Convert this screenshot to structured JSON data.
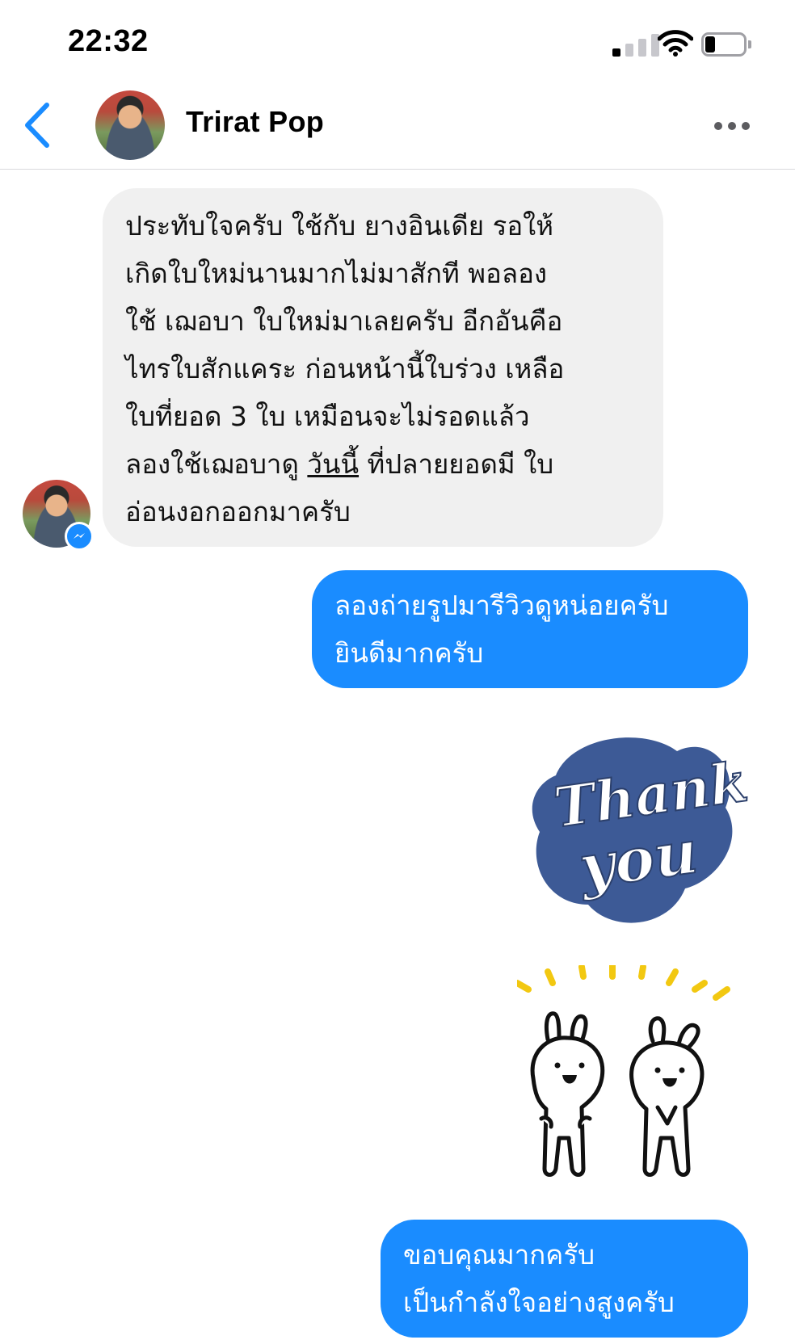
{
  "status_bar": {
    "time": "22:32",
    "signal_bars_on": 1,
    "signal_bars_total": 4,
    "battery_level": 0.2
  },
  "header": {
    "contact_name": "Trirat Pop",
    "back_icon": "chevron-left-icon",
    "more_icon": "more-horizontal-icon"
  },
  "messages": {
    "incoming_1": {
      "line1": "ประทับใจครับ ใช้กับ ยางอินเดีย รอให้",
      "line2": "เกิดใบใหม่นานมากไม่มาสักที พอลอง",
      "line3": "ใช้ เฌอบา ใบใหม่มาเลยครับ อีกอันคือ",
      "line4": "ไทรใบสักแคระ ก่อนหน้านี้ใบร่วง เหลือ",
      "line5": "ใบที่ยอด 3 ใบ เหมือนจะไม่รอดแล้ว",
      "line6_a": "ลองใช้เฌอบาดู ",
      "line6_link": "วันนี้",
      "line6_b": " ที่ปลายยอดมี ใบ",
      "line7": "อ่อนงอกออกมาครับ"
    },
    "outgoing_1": {
      "line1": "ลองถ่ายรูปมารีวิวดูหน่อยครับ",
      "line2": "ยินดีมากครับ"
    },
    "sticker_1": {
      "text_top": "Thank",
      "text_bottom": "you",
      "color": "#3d5a96"
    },
    "sticker_2": {
      "name": "rabbits-thanks-sticker",
      "accent": "#f2c811"
    },
    "outgoing_2": {
      "line1": "ขอบคุณมากครับ",
      "line2": "เป็นกำลังใจอย่างสูงครับ"
    }
  },
  "colors": {
    "accent": "#1a8cff",
    "incoming_bubble": "#f0f0f0",
    "divider": "#d9d9dc"
  }
}
